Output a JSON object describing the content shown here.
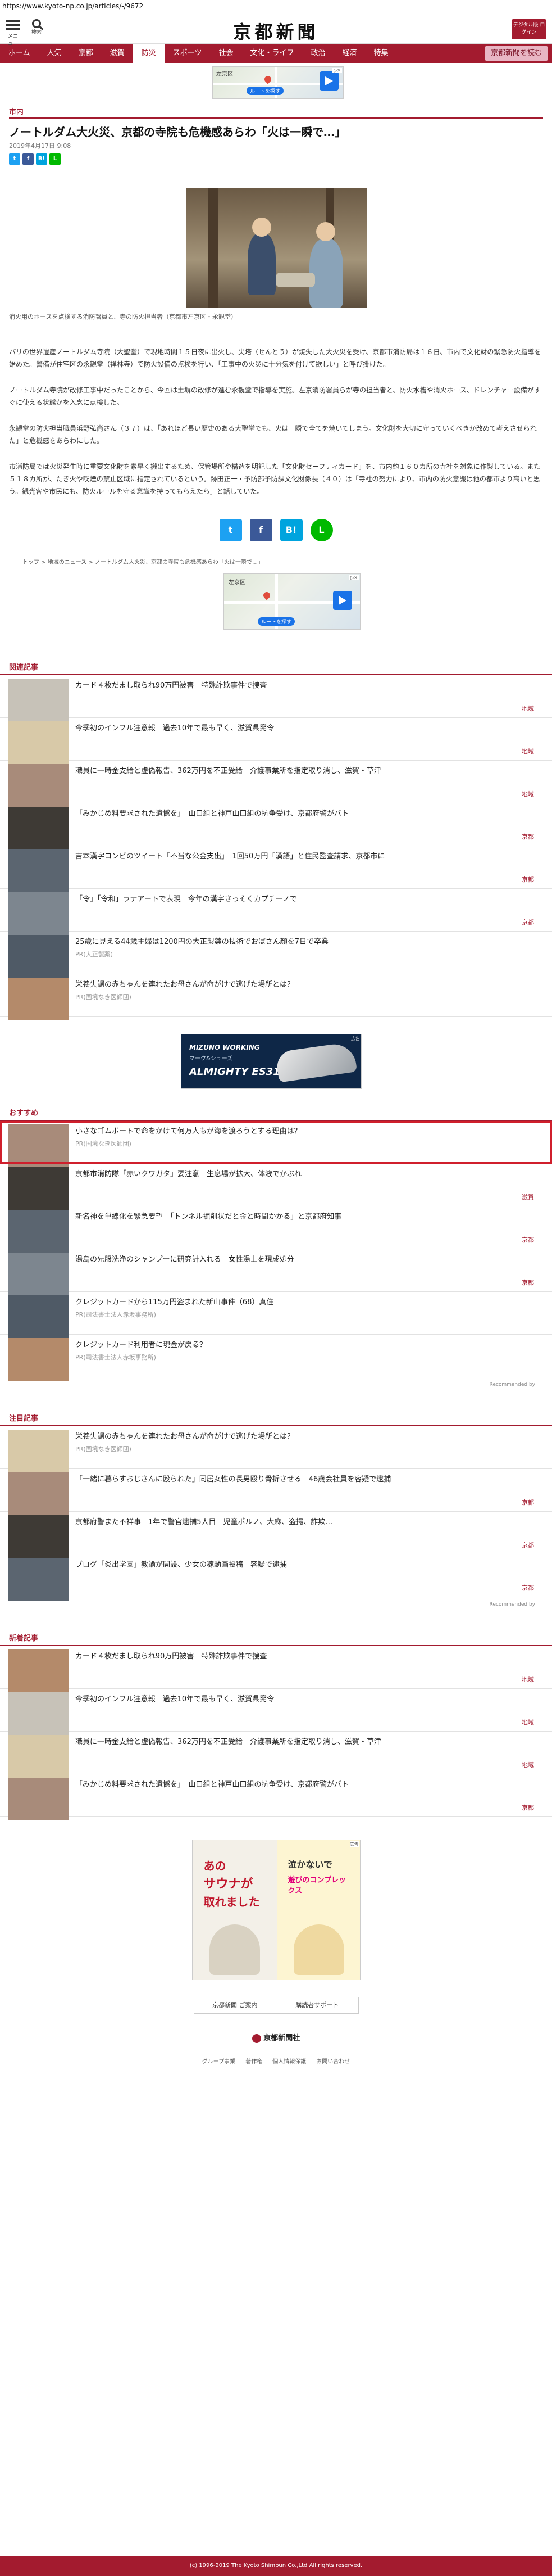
{
  "url": "https://www.kyoto-np.co.jp/articles/-/9672",
  "header": {
    "menu_label": "メニュー",
    "search_label": "検索",
    "logo": "京都新聞",
    "digital_badge": "デジタル版 ログイン"
  },
  "nav": [
    {
      "label": "ホーム",
      "active": false
    },
    {
      "label": "人気",
      "active": false
    },
    {
      "label": "京都",
      "active": false
    },
    {
      "label": "滋賀",
      "active": false
    },
    {
      "label": "防災",
      "active": true
    },
    {
      "label": "スポーツ",
      "active": false
    },
    {
      "label": "社会",
      "active": false
    },
    {
      "label": "文化・ライフ",
      "active": false
    },
    {
      "label": "政治",
      "active": false
    },
    {
      "label": "経済",
      "active": false
    },
    {
      "label": "特集",
      "active": false
    },
    {
      "label": "京都新聞を読む",
      "active": false,
      "special": true
    }
  ],
  "top_ad": {
    "place": "左京区",
    "button": "ルートを探す"
  },
  "article": {
    "category": "市内",
    "title": "ノートルダム大火災、京都の寺院も危機感あらわ「火は一瞬で…」",
    "date": "2019年4月17日 9:08",
    "caption": "消火用のホースを点検する消防署員と、寺の防火担当者（京都市左京区・永観堂）",
    "paragraphs": [
      "パリの世界遺産ノートルダム寺院（大聖堂）で現地時間１５日夜に出火し、尖塔（せんとう）が焼失した大火災を受け、京都市消防局は１６日、市内で文化財の緊急防火指導を始めた。警備が住宅区の永観堂（禅林寺）で防火設備の点検を行い、「工事中の火災に十分気を付けて欲しい」と呼び掛けた。",
      "ノートルダム寺院が改修工事中だったことから、今回は土塀の改修が進む永観堂で指導を実施。左京消防署員らが寺の担当者と、防火水槽や消火ホース、ドレンチャー設備がすぐに使える状態かを入念に点検した。",
      "永観堂の防火担当職員浜野弘尚さん（３７）は、「あれほど長い歴史のある大聖堂でも、火は一瞬で全てを焼いてしまう。文化財を大切に守っていくべきか改めて考えさせられた」と危機感をあらわにした。",
      "市消防局では火災発生時に重要文化財を素早く搬出するため、保管場所や構造を明記した「文化財セーフティカード」を、市内約１６０カ所の寺社を対象に作製している。また５１８カ所が、たき火や喫煙の禁止区域に指定されているという。跡田正一・予防部予防課文化財係長（４０）は「寺社の努力により、市内の防火意識は他の都市より高いと思う。観光客や市民にも、防火ルールを守る意識を持ってもらえたら」と話していた。"
    ]
  },
  "breadcrumb": [
    "トップ",
    "地域のニュース",
    "ノートルダム大火災、京都の寺院も危機感あらわ「火は一瞬で…」"
  ],
  "related": {
    "heading": "関連記事",
    "items": [
      {
        "title": "カード４枚だまし取られ90万円被害　特殊詐欺事件で捜査",
        "cat": "地域"
      },
      {
        "title": "今季初のインフル注意報　過去10年で最も早く、滋賀県発令",
        "cat": "地域"
      },
      {
        "title": "職員に一時金支給と虚偽報告、362万円を不正受給　介護事業所を指定取り消し、滋賀・草津",
        "cat": "地域"
      },
      {
        "title": "「みかじめ料要求された遺憾を」　山口組と神戸山口組の抗争受け、京都府警がパト",
        "cat": "京都"
      },
      {
        "title": "吉本漢字コンビのツイート「不当な公金支出」　1回50万円「漢語」と住民監査請求、京都市に",
        "cat": "京都"
      },
      {
        "title": "「令」「令和」ラテアートで表現　今年の漢字さっそくカプチーノで",
        "cat": "京都"
      },
      {
        "title": "25歳に見える44歳主婦は1200円の大正製薬の技術でおばさん顔を7日で卒業",
        "pr": "PR(大正製薬)"
      },
      {
        "title": "栄養失調の赤ちゃんを連れたお母さんが命がけで逃げた場所とは？",
        "pr": "PR(国境なき医師団)"
      }
    ]
  },
  "mid_ad": {
    "brand": "MIZUNO WORKING",
    "sub": "マーク&シューズ",
    "model": "ALMIGHTY ES31L",
    "tag": "広告"
  },
  "recommend": {
    "heading": "おすすめ",
    "items": [
      {
        "title": "小さなゴムボートで命をかけて何万人もが海を渡ろうとする理由は？",
        "pr": "PR(国境なき医師団)",
        "highlight": true
      },
      {
        "title": "京都市消防隊「赤いクワガタ」要注意　生息場が拡大、体液でかぶれ",
        "cat": "滋賀"
      },
      {
        "title": "新名神を単線化を緊急要望　「トンネル掘削状だと金と時間かかる」と京都府知事",
        "cat": "京都"
      },
      {
        "title": "湯島の先服洗浄のシャンプーに研究計入れる　女性湯士を現成処分",
        "cat": "京都"
      },
      {
        "title": "クレジットカードから115万円盗まれた新山事件（68）真住",
        "pr": "PR(司法書士法人赤坂事務所)"
      },
      {
        "title": "クレジットカード利用者に現金が戻る？",
        "pr": "PR(司法書士法人赤坂事務所)"
      }
    ],
    "by": "Recommended by"
  },
  "featured": {
    "heading": "注目記事",
    "items": [
      {
        "title": "栄養失調の赤ちゃんを連れたお母さんが命がけで逃げた場所とは？",
        "pr": "PR(国境なき医師団)"
      },
      {
        "title": "「一緒に暮らすおじさんに殴られた」同居女性の長男殴り骨折させる　46歳会社員を容疑で逮捕",
        "cat": "京都"
      },
      {
        "title": "京都府警また不祥事　1年で警官逮捕5人目　児童ポルノ、大麻、盗撮、詐欺…",
        "cat": "京都"
      },
      {
        "title": "ブログ「炎出学園」教諭が開設、少女の稼動画投稿　容疑で逮捕",
        "cat": "京都"
      }
    ],
    "by": "Recommended by"
  },
  "latest": {
    "heading": "新着記事",
    "items": [
      {
        "title": "カード４枚だまし取られ90万円被害　特殊詐欺事件で捜査",
        "cat": "地域"
      },
      {
        "title": "今季初のインフル注意報　過去10年で最も早く、滋賀県発令",
        "cat": "地域"
      },
      {
        "title": "職員に一時金支給と虚偽報告、362万円を不正受給　介護事業所を指定取り消し、滋賀・草津",
        "cat": "地域"
      },
      {
        "title": "「みかじめ料要求された遺憾を」　山口組と神戸山口組の抗争受け、京都府警がパト",
        "cat": "京都"
      }
    ]
  },
  "bottom_ad": {
    "line1": "あの",
    "line2": "サウナが",
    "line3": "取れました",
    "right": "泣かないで",
    "right2": "遊びのコンプレックス",
    "tag": "広告"
  },
  "footer": {
    "links": [
      "京都新聞 ご案内",
      "購読者サポート"
    ],
    "logo": "京都新聞社",
    "nav": [
      "グループ事業",
      "著作権",
      "個人情報保護",
      "お問い合わせ"
    ],
    "copyright": "(c) 1996-2019 The Kyoto Shimbun Co.,Ltd All rights reserved."
  },
  "colors": {
    "brand": "#a31b2f"
  }
}
